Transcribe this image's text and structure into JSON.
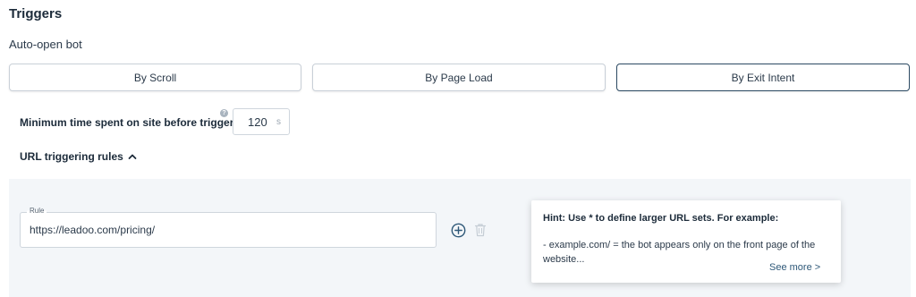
{
  "section": {
    "title": "Triggers",
    "subtitle": "Auto-open bot"
  },
  "modes": {
    "items": [
      "By Scroll",
      "By Page Load",
      "By Exit Intent"
    ],
    "selected": "By Exit Intent"
  },
  "min_time": {
    "label": "Minimum time spent on site before triggering",
    "help": "?",
    "value": "120",
    "unit": "s"
  },
  "url_rules": {
    "label": "URL triggering rules",
    "expanded": true,
    "rule": {
      "label": "Rule",
      "value": "https://leadoo.com/pricing/"
    }
  },
  "hint": {
    "title": "Hint: Use * to define larger URL sets. For example:",
    "body": "- example.com/ = the bot appears only on the front page of the website...",
    "see_more": "See more >"
  },
  "colors": {
    "active_border": "#2c4a63",
    "panel_bg": "#f3f6f9",
    "icon_blue": "#2e5878"
  }
}
